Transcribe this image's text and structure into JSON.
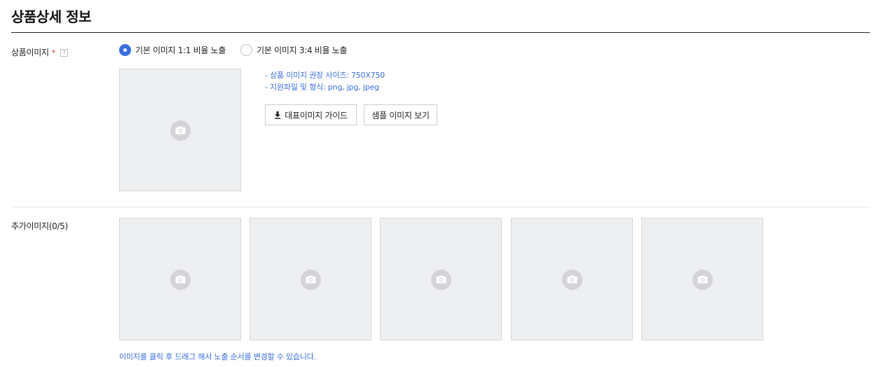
{
  "page": {
    "title": "상품상세 정보"
  },
  "main_image": {
    "label": "상품이미지",
    "required_mark": "*",
    "help_mark": "?",
    "radio_options": [
      {
        "label": "기본 이미지 1:1 비율 노출",
        "checked": true
      },
      {
        "label": "기본 이미지 3:4 비율 노출",
        "checked": false
      }
    ],
    "guide_lines": [
      "- 상품 이미지 권장 사이즈: 750X750",
      "- 지원파일 및 형식: png, jpg, jpeg"
    ],
    "buttons": {
      "guide_label": "대표이미지 가이드",
      "sample_label": "샘플 이미지 보기"
    }
  },
  "additional_images": {
    "label": "추가이미지(0/5)",
    "slot_count": 5,
    "note": "이미지를 클릭 후 드래그 해서 노출 순서를 변경할 수 있습니다."
  },
  "colors": {
    "accent": "#3a6ee0",
    "required": "#e0292f",
    "placeholder_bg": "#eeeff1"
  },
  "icons": {
    "upload_placeholder": "camera-icon",
    "download": "download-icon"
  }
}
